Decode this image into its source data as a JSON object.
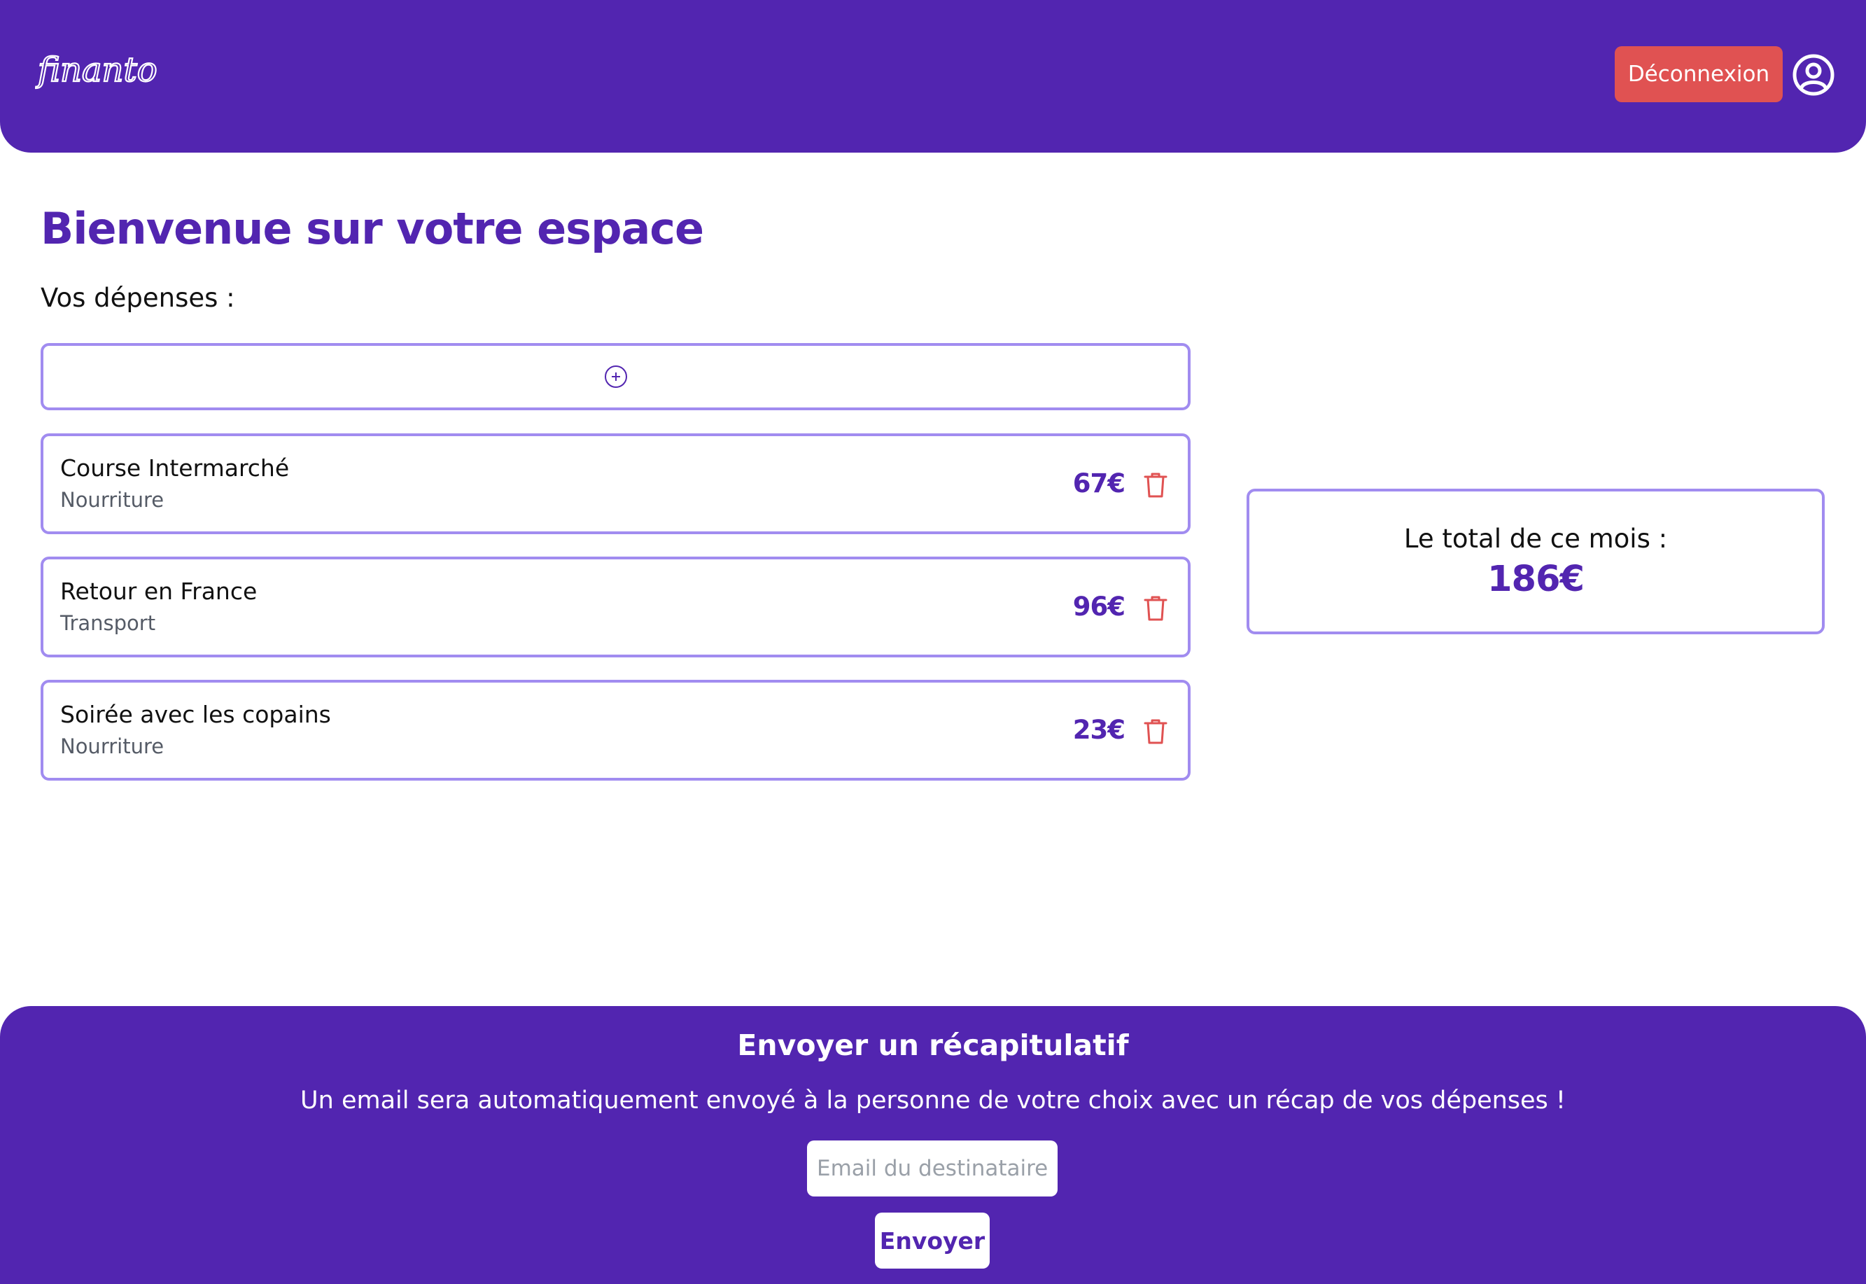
{
  "header": {
    "logo_alt": "finanto",
    "logout_label": "Déconnexion",
    "avatar_icon": "user-circle-icon"
  },
  "main": {
    "title": "Bienvenue sur votre espace",
    "expenses_label": "Vos dépenses :",
    "add_icon": "plus-circle-icon",
    "expenses": [
      {
        "name": "Course Intermarché",
        "category": "Nourriture",
        "amount": "67€"
      },
      {
        "name": "Retour en France",
        "category": "Transport",
        "amount": "96€"
      },
      {
        "name": "Soirée avec les copains",
        "category": "Nourriture",
        "amount": "23€"
      }
    ],
    "delete_icon": "trash-icon",
    "total": {
      "label": "Le total de ce mois :",
      "value": "186€"
    }
  },
  "footer": {
    "title": "Envoyer un récapitulatif",
    "description": "Un email sera automatiquement envoyé à la personne de votre choix avec un récap de vos dépenses !",
    "email_placeholder": "Email du destinataire",
    "email_value": "",
    "send_label": "Envoyer"
  },
  "colors": {
    "primary": "#5225b0",
    "border": "#a18cf0",
    "danger": "#e05252",
    "background": "#ffffff"
  }
}
